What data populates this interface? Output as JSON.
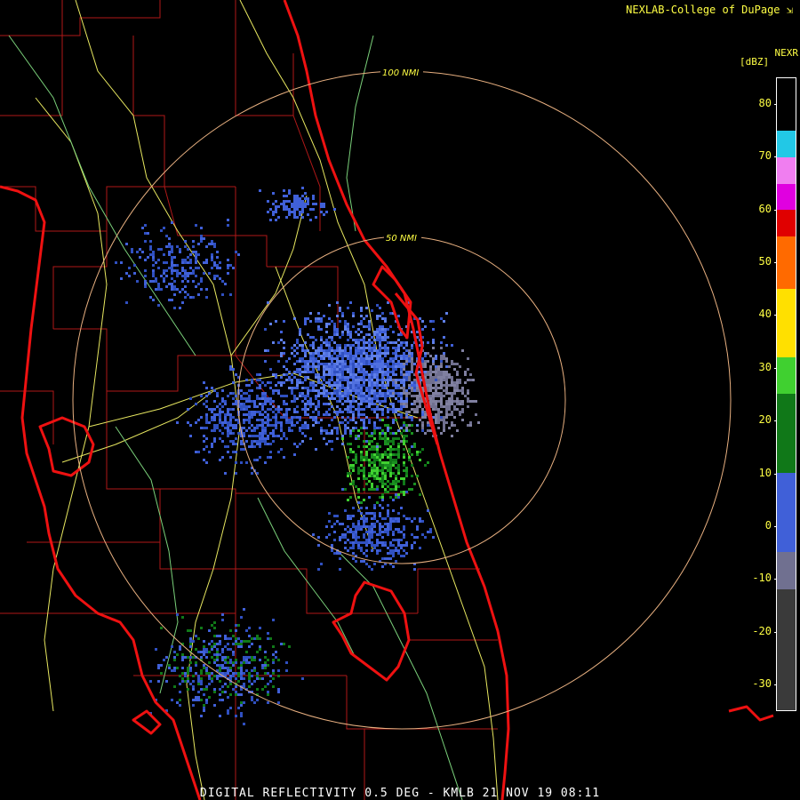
{
  "credit": "NEXLAB-College of DuPage",
  "product": "NEXR",
  "unit": "[dBZ]",
  "caption": "DIGITAL REFLECTIVITY 0.5 DEG - KMLB 21 NOV 19 08:11",
  "range_rings": [
    {
      "label": "100 NMI",
      "range_nmi": 100
    },
    {
      "label": "50 NMI",
      "range_nmi": 50
    }
  ],
  "legend": {
    "ticks": [
      "80",
      "70",
      "60",
      "50",
      "40",
      "30",
      "20",
      "10",
      "0",
      "-10",
      "-20",
      "-30"
    ],
    "bands": [
      {
        "from_dbz": 75,
        "to_dbz": 85,
        "color": "#000000"
      },
      {
        "from_dbz": 70,
        "to_dbz": 75,
        "color": "#22c8e6"
      },
      {
        "from_dbz": 65,
        "to_dbz": 70,
        "color": "#f07ef0"
      },
      {
        "from_dbz": 60,
        "to_dbz": 65,
        "color": "#e000e0"
      },
      {
        "from_dbz": 55,
        "to_dbz": 60,
        "color": "#e00000"
      },
      {
        "from_dbz": 45,
        "to_dbz": 55,
        "color": "#ff6a00"
      },
      {
        "from_dbz": 32,
        "to_dbz": 45,
        "color": "#ffe000"
      },
      {
        "from_dbz": 25,
        "to_dbz": 32,
        "color": "#40d030"
      },
      {
        "from_dbz": 10,
        "to_dbz": 25,
        "color": "#107818"
      },
      {
        "from_dbz": -5,
        "to_dbz": 10,
        "color": "#4060d8"
      },
      {
        "from_dbz": -12,
        "to_dbz": -5,
        "color": "#707090"
      },
      {
        "from_dbz": -35,
        "to_dbz": -12,
        "color": "#3a3a3a"
      }
    ]
  },
  "colors": {
    "coast": "#ee1111",
    "county": "#b01818",
    "road": "#e8e860",
    "road_green": "#7ad07a",
    "ring": "#e8b080",
    "ring_label": "#ffff44"
  }
}
